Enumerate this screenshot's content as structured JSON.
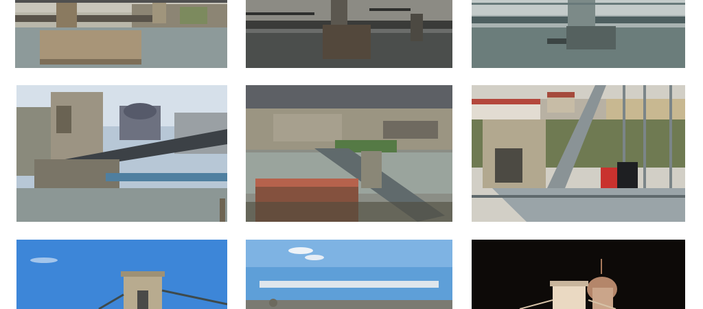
{
  "gallery": {
    "items": [
      {
        "scene": "bridge-pier-riverside-dusk"
      },
      {
        "scene": "bridge-overcast-dark-water"
      },
      {
        "scene": "bridge-misty-river-boat"
      },
      {
        "scene": "bridge-lion-tower-arch-closeup"
      },
      {
        "scene": "bridge-aerial-city-view"
      },
      {
        "scene": "bridge-walkway-couple"
      },
      {
        "scene": "bridge-tower-blue-sky"
      },
      {
        "scene": "city-panorama-blue-sky"
      },
      {
        "scene": "bridge-night-parliament-dome"
      }
    ]
  },
  "colors": {
    "sky_blue": "#3d86d8",
    "river": "#7d8f92",
    "stone": "#a48f72",
    "night": "#0d0a08"
  }
}
